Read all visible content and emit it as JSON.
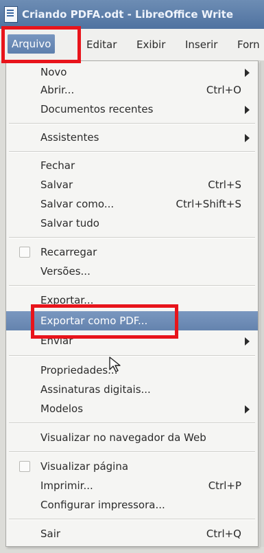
{
  "window": {
    "title": "Criando PDFA.odt - LibreOffice Write"
  },
  "menubar": [
    {
      "label": "Arquivo",
      "active": true
    },
    {
      "label": "Editar"
    },
    {
      "label": "Exibir"
    },
    {
      "label": "Inserir"
    },
    {
      "label": "Forn"
    }
  ],
  "menu": {
    "items": [
      {
        "label": "Novo",
        "submenu": true
      },
      {
        "label": "Abrir...",
        "shortcut": "Ctrl+O"
      },
      {
        "label": "Documentos recentes",
        "submenu": true
      },
      {
        "label": "Assistentes",
        "submenu": true
      },
      {
        "label": "Fechar"
      },
      {
        "label": "Salvar",
        "shortcut": "Ctrl+S"
      },
      {
        "label": "Salvar como...",
        "shortcut": "Ctrl+Shift+S"
      },
      {
        "label": "Salvar tudo"
      },
      {
        "label": "Recarregar",
        "checkbox": true
      },
      {
        "label": "Versões..."
      },
      {
        "label": "Exportar..."
      },
      {
        "label": "Exportar como PDF...",
        "selected": true
      },
      {
        "label": "Enviar",
        "submenu": true
      },
      {
        "label": "Propriedades..."
      },
      {
        "label": "Assinaturas digitais..."
      },
      {
        "label": "Modelos",
        "submenu": true
      },
      {
        "label": "Visualizar no navegador da Web"
      },
      {
        "label": "Visualizar página",
        "checkbox": true
      },
      {
        "label": "Imprimir...",
        "shortcut": "Ctrl+P"
      },
      {
        "label": "Configurar impressora..."
      },
      {
        "label": "Sair",
        "shortcut": "Ctrl+Q"
      }
    ]
  },
  "colors": {
    "highlight_box": "#e8141b",
    "selection": "#6483ae",
    "titlebar": "#4f72a0"
  }
}
